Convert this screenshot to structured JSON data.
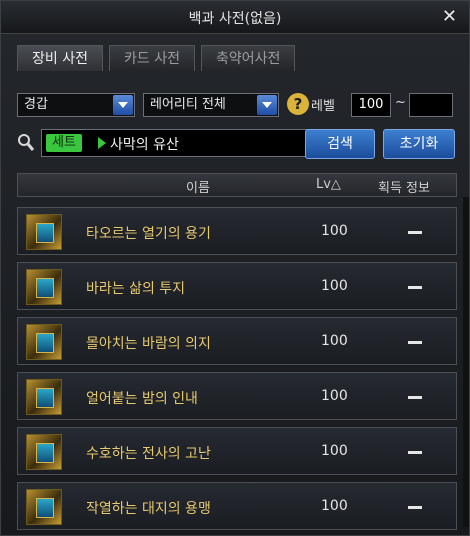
{
  "window": {
    "title": "백과 사전(없음)",
    "close_glyph": "✕"
  },
  "tabs": [
    {
      "label": "장비 사전",
      "active": true
    },
    {
      "label": "카드 사전",
      "active": false
    },
    {
      "label": "축약어사전",
      "active": false
    }
  ],
  "filters": {
    "category": "경갑",
    "rarity": "레어리티 전체",
    "help_glyph": "?",
    "level_label": "레벨",
    "level_min": "100",
    "tilde": "~",
    "level_max": ""
  },
  "search": {
    "tag": "세트",
    "value": "사막의 유산",
    "search_button": "검색",
    "reset_button": "초기화"
  },
  "table": {
    "headers": {
      "name": "이름",
      "lv": "Lv△",
      "info": "획득 정보"
    },
    "rows": [
      {
        "name": "타오르는 열기의 용기",
        "lv": "100"
      },
      {
        "name": "바라는 삶의 투지",
        "lv": "100"
      },
      {
        "name": "몰아치는 바람의 의지",
        "lv": "100"
      },
      {
        "name": "얼어붙는 밤의 인내",
        "lv": "100"
      },
      {
        "name": "수호하는 전사의 고난",
        "lv": "100"
      },
      {
        "name": "작열하는 대지의 용맹",
        "lv": "100"
      }
    ]
  },
  "colors": {
    "accent": "#2f6fc4",
    "tag": "#3ac63e",
    "item_name": "#e7c96e"
  }
}
